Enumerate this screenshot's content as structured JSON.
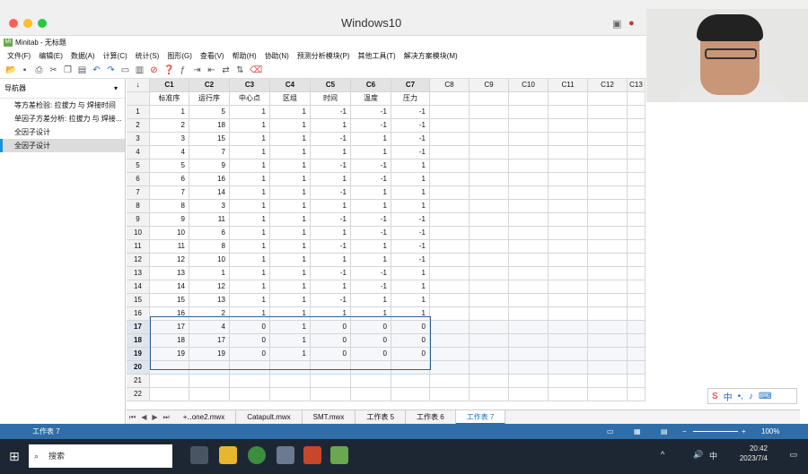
{
  "window": {
    "title": "Windows10",
    "app_title": "Minitab - 无标题",
    "app_logo": "Mt"
  },
  "menu": [
    "文件(F)",
    "编辑(E)",
    "数据(A)",
    "计算(C)",
    "统计(S)",
    "图形(G)",
    "查看(V)",
    "帮助(H)",
    "协助(N)",
    "预测分析模块(P)",
    "其他工具(T)",
    "解决方案模块(M)"
  ],
  "navigator": {
    "title": "导航器",
    "items": [
      "等方差检验: 拉拔力 与 焊接时间",
      "单因子方差分析: 拉拔力 与 焊接...",
      "全因子设计",
      "全因子设计"
    ],
    "selected_index": 3
  },
  "columns": [
    "C1",
    "C2",
    "C3",
    "C4",
    "C5",
    "C6",
    "C7",
    "C8",
    "C9",
    "C10",
    "C11",
    "C12",
    "C13"
  ],
  "col_names": [
    "标准序",
    "运行序",
    "中心点",
    "区组",
    "时间",
    "温度",
    "压力",
    "",
    "",
    "",
    "",
    "",
    ""
  ],
  "rows": [
    [
      "1",
      "5",
      "1",
      "1",
      "-1",
      "-1",
      "-1"
    ],
    [
      "2",
      "18",
      "1",
      "1",
      "1",
      "-1",
      "-1"
    ],
    [
      "3",
      "15",
      "1",
      "1",
      "-1",
      "1",
      "-1"
    ],
    [
      "4",
      "7",
      "1",
      "1",
      "1",
      "1",
      "-1"
    ],
    [
      "5",
      "9",
      "1",
      "1",
      "-1",
      "-1",
      "1"
    ],
    [
      "6",
      "16",
      "1",
      "1",
      "1",
      "-1",
      "1"
    ],
    [
      "7",
      "14",
      "1",
      "1",
      "-1",
      "1",
      "1"
    ],
    [
      "8",
      "3",
      "1",
      "1",
      "1",
      "1",
      "1"
    ],
    [
      "9",
      "11",
      "1",
      "1",
      "-1",
      "-1",
      "-1"
    ],
    [
      "10",
      "6",
      "1",
      "1",
      "1",
      "-1",
      "-1"
    ],
    [
      "11",
      "8",
      "1",
      "1",
      "-1",
      "1",
      "-1"
    ],
    [
      "12",
      "10",
      "1",
      "1",
      "1",
      "1",
      "-1"
    ],
    [
      "13",
      "1",
      "1",
      "1",
      "-1",
      "-1",
      "1"
    ],
    [
      "14",
      "12",
      "1",
      "1",
      "1",
      "-1",
      "1"
    ],
    [
      "15",
      "13",
      "1",
      "1",
      "-1",
      "1",
      "1"
    ],
    [
      "16",
      "2",
      "1",
      "1",
      "1",
      "1",
      "1"
    ],
    [
      "17",
      "4",
      "0",
      "1",
      "0",
      "0",
      "0"
    ],
    [
      "18",
      "17",
      "0",
      "1",
      "0",
      "0",
      "0"
    ],
    [
      "19",
      "19",
      "0",
      "1",
      "0",
      "0",
      "0"
    ],
    [
      "",
      "",
      "",
      "",
      "",
      "",
      ""
    ],
    [
      "",
      "",
      "",
      "",
      "",
      "",
      ""
    ],
    [
      "",
      "",
      "",
      "",
      "",
      "",
      ""
    ]
  ],
  "tabs": [
    "+‥one2.mwx",
    "Catapult.mwx",
    "SMT.mwx",
    "工作表 5",
    "工作表 6",
    "工作表 7"
  ],
  "active_tab": 5,
  "status": {
    "sheet": "工作表 7",
    "zoom": "100%"
  },
  "taskbar": {
    "search": "搜索",
    "time": "20:42",
    "date": "2023/7/4",
    "ime": "中"
  },
  "colors": {
    "accent": "#2f6ea8",
    "selection": "#1e90d8"
  }
}
